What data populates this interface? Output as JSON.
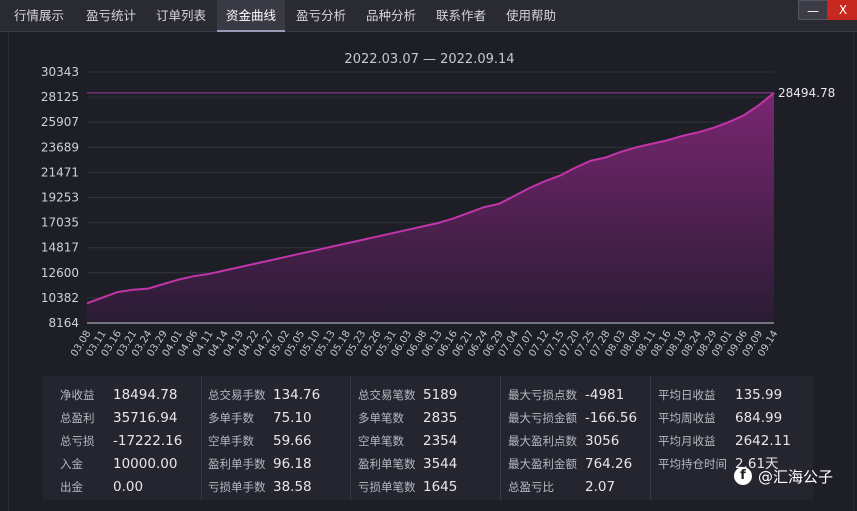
{
  "tabs": [
    {
      "label": "行情展示"
    },
    {
      "label": "盈亏统计"
    },
    {
      "label": "订单列表"
    },
    {
      "label": "资金曲线"
    },
    {
      "label": "盈亏分析"
    },
    {
      "label": "品种分析"
    },
    {
      "label": "联系作者"
    },
    {
      "label": "使用帮助"
    }
  ],
  "window": {
    "minimize_label": "—",
    "close_label": "X"
  },
  "chart_data": {
    "type": "area",
    "title": "2022.03.07 — 2022.09.14",
    "y_ticks": [
      8164,
      10382,
      12600,
      14817,
      17035,
      19253,
      21471,
      23689,
      25907,
      28125,
      30343
    ],
    "ylim": [
      8164,
      30343
    ],
    "end_label": "28494.78",
    "x_ticks": [
      "03.08",
      "03.11",
      "03.16",
      "03.21",
      "03.24",
      "03.29",
      "04.01",
      "04.06",
      "04.11",
      "04.14",
      "04.19",
      "04.22",
      "04.27",
      "05.02",
      "05.05",
      "05.10",
      "05.13",
      "05.18",
      "05.23",
      "05.26",
      "05.31",
      "06.03",
      "06.08",
      "06.13",
      "06.16",
      "06.21",
      "06.24",
      "06.29",
      "07.04",
      "07.07",
      "07.12",
      "07.15",
      "07.20",
      "07.25",
      "07.28",
      "08.03",
      "08.08",
      "08.11",
      "08.16",
      "08.19",
      "08.24",
      "08.29",
      "09.01",
      "09.06",
      "09.09",
      "09.14"
    ],
    "series": [
      {
        "values": [
          9900,
          10400,
          10900,
          11100,
          11200,
          11600,
          12000,
          12300,
          12500,
          12800,
          13100,
          13400,
          13700,
          14000,
          14300,
          14600,
          14900,
          15200,
          15500,
          15800,
          16100,
          16400,
          16700,
          17000,
          17400,
          17900,
          18400,
          18700,
          19400,
          20100,
          20700,
          21200,
          21900,
          22500,
          22800,
          23300,
          23700,
          24000,
          24300,
          24700,
          25000,
          25400,
          25900,
          26500,
          27400,
          28494.78
        ]
      }
    ],
    "colors": {
      "line": "#c235a8",
      "fill_top": "#7a2672",
      "fill_bottom": "#2a1c34",
      "ref_line": "#9e3b95"
    }
  },
  "stats": {
    "columns": [
      [
        {
          "label": "净收益",
          "value": "18494.78"
        },
        {
          "label": "总盈利",
          "value": "35716.94"
        },
        {
          "label": "总亏损",
          "value": "-17222.16"
        },
        {
          "label": "入金",
          "value": "10000.00"
        },
        {
          "label": "出金",
          "value": "0.00"
        }
      ],
      [
        {
          "label": "总交易手数",
          "value": "134.76"
        },
        {
          "label": "多单手数",
          "value": "75.10"
        },
        {
          "label": "空单手数",
          "value": "59.66"
        },
        {
          "label": "盈利单手数",
          "value": "96.18"
        },
        {
          "label": "亏损单手数",
          "value": "38.58"
        }
      ],
      [
        {
          "label": "总交易笔数",
          "value": "5189"
        },
        {
          "label": "多单笔数",
          "value": "2835"
        },
        {
          "label": "空单笔数",
          "value": "2354"
        },
        {
          "label": "盈利单笔数",
          "value": "3544"
        },
        {
          "label": "亏损单笔数",
          "value": "1645"
        }
      ],
      [
        {
          "label": "最大亏损点数",
          "value": "-4981"
        },
        {
          "label": "最大亏损金额",
          "value": "-166.56"
        },
        {
          "label": "最大盈利点数",
          "value": "3056"
        },
        {
          "label": "最大盈利金额",
          "value": "764.26"
        },
        {
          "label": "总盈亏比",
          "value": "2.07"
        }
      ],
      [
        {
          "label": "平均日收益",
          "value": "135.99"
        },
        {
          "label": "平均周收益",
          "value": "684.99"
        },
        {
          "label": "平均月收益",
          "value": "2642.11"
        },
        {
          "label": "平均持仓时间",
          "value": "2.61天"
        }
      ]
    ]
  },
  "watermark": {
    "icon": "f",
    "text": "@汇海公子"
  }
}
